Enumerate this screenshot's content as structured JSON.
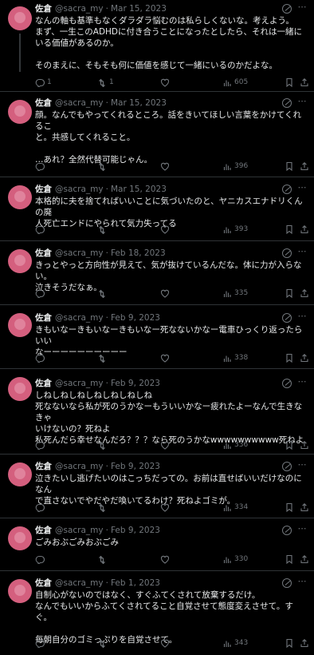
{
  "colors": {
    "background": "#000000",
    "text": "#e7e9ea",
    "muted": "#71767b",
    "divider": "#2f3336",
    "avatar": "#d45f7e"
  },
  "icons": [
    "grok-icon",
    "more-icon",
    "reply-icon",
    "retweet-icon",
    "like-icon",
    "views-icon",
    "bookmark-icon",
    "share-icon"
  ],
  "tweets": [
    {
      "name": "佐倉",
      "handle": "@sacra_my",
      "dot": "·",
      "date": "Mar 15, 2023",
      "text": "なんの軸も基準もなくダラダラ悩むのは私らしくないな。考えよう。\nまず、一生このADHDに付き合うことになったとしたら、それは一緒にいる価値があるのか。\n\nそのまえに、そもそも何に価値を感じて一緒にいるのかだよな。",
      "replies": "1",
      "retweets": "1",
      "likes": "",
      "views": "605"
    },
    {
      "name": "佐倉",
      "handle": "@sacra_my",
      "dot": "·",
      "date": "Mar 15, 2023",
      "text": "顔。なんでもやってくれるところ。話をきいてほしい言葉をかけてくれるこ\nと。共感してくれること。\n\n…あれ？全然代替可能じゃん。",
      "replies": "",
      "retweets": "",
      "likes": "",
      "views": "396"
    },
    {
      "name": "佐倉",
      "handle": "@sacra_my",
      "dot": "·",
      "date": "Mar 15, 2023",
      "text": "本格的に夫を捨てればいいことに気づいたのと、ヤニカスエナドリくんの廃\n人死亡エンドにやられて気力失ってる",
      "replies": "",
      "retweets": "",
      "likes": "",
      "views": "393"
    },
    {
      "name": "佐倉",
      "handle": "@sacra_my",
      "dot": "·",
      "date": "Feb 18, 2023",
      "text": "きっとやっと方向性が見えて、気が抜けているんだな。体に力が入らない。\n泣きそうだなぁ。",
      "replies": "",
      "retweets": "",
      "likes": "",
      "views": "335"
    },
    {
      "name": "佐倉",
      "handle": "@sacra_my",
      "dot": "·",
      "date": "Feb 9, 2023",
      "text": "きもいなーきもいなーきもいなー死なないかなー電車ひっくり返ったらいい\nなーーーーーーーーーー",
      "replies": "",
      "retweets": "",
      "likes": "",
      "views": "338"
    },
    {
      "name": "佐倉",
      "handle": "@sacra_my",
      "dot": "·",
      "date": "Feb 9, 2023",
      "text": "しねしねしねしねしねしねしね\n死なないなら私が死のうかなーもういいかなー疲れたよーなんで生きなきゃ\nいけないの？死ねよ\n私死んだら幸せなんだろ？？？なら死のうかなwwwwwwwwww死ねよ",
      "replies": "",
      "retweets": "",
      "likes": "",
      "views": "336"
    },
    {
      "name": "佐倉",
      "handle": "@sacra_my",
      "dot": "·",
      "date": "Feb 9, 2023",
      "text": "泣きたいし逃げたいのはこっちだっての。お前は直せばいいだけなのになん\nで直さないでやだやだ喚いてるわけ？死ねよゴミが。",
      "replies": "",
      "retweets": "",
      "likes": "",
      "views": "334"
    },
    {
      "name": "佐倉",
      "handle": "@sacra_my",
      "dot": "·",
      "date": "Feb 9, 2023",
      "text": "ごみおぶごみおぶごみ",
      "replies": "",
      "retweets": "",
      "likes": "",
      "views": "330"
    },
    {
      "name": "佐倉",
      "handle": "@sacra_my",
      "dot": "·",
      "date": "Feb 1, 2023",
      "text": "自制心がないのではなく、すぐふてくされて放棄するだけ。\nなんでもいいからふてくされてること自覚させて態度変えさせて。すぐ。\n\n毎朝自分のゴミっぷりを自覚させて。",
      "replies": "",
      "retweets": "",
      "likes": "",
      "views": "343"
    }
  ]
}
